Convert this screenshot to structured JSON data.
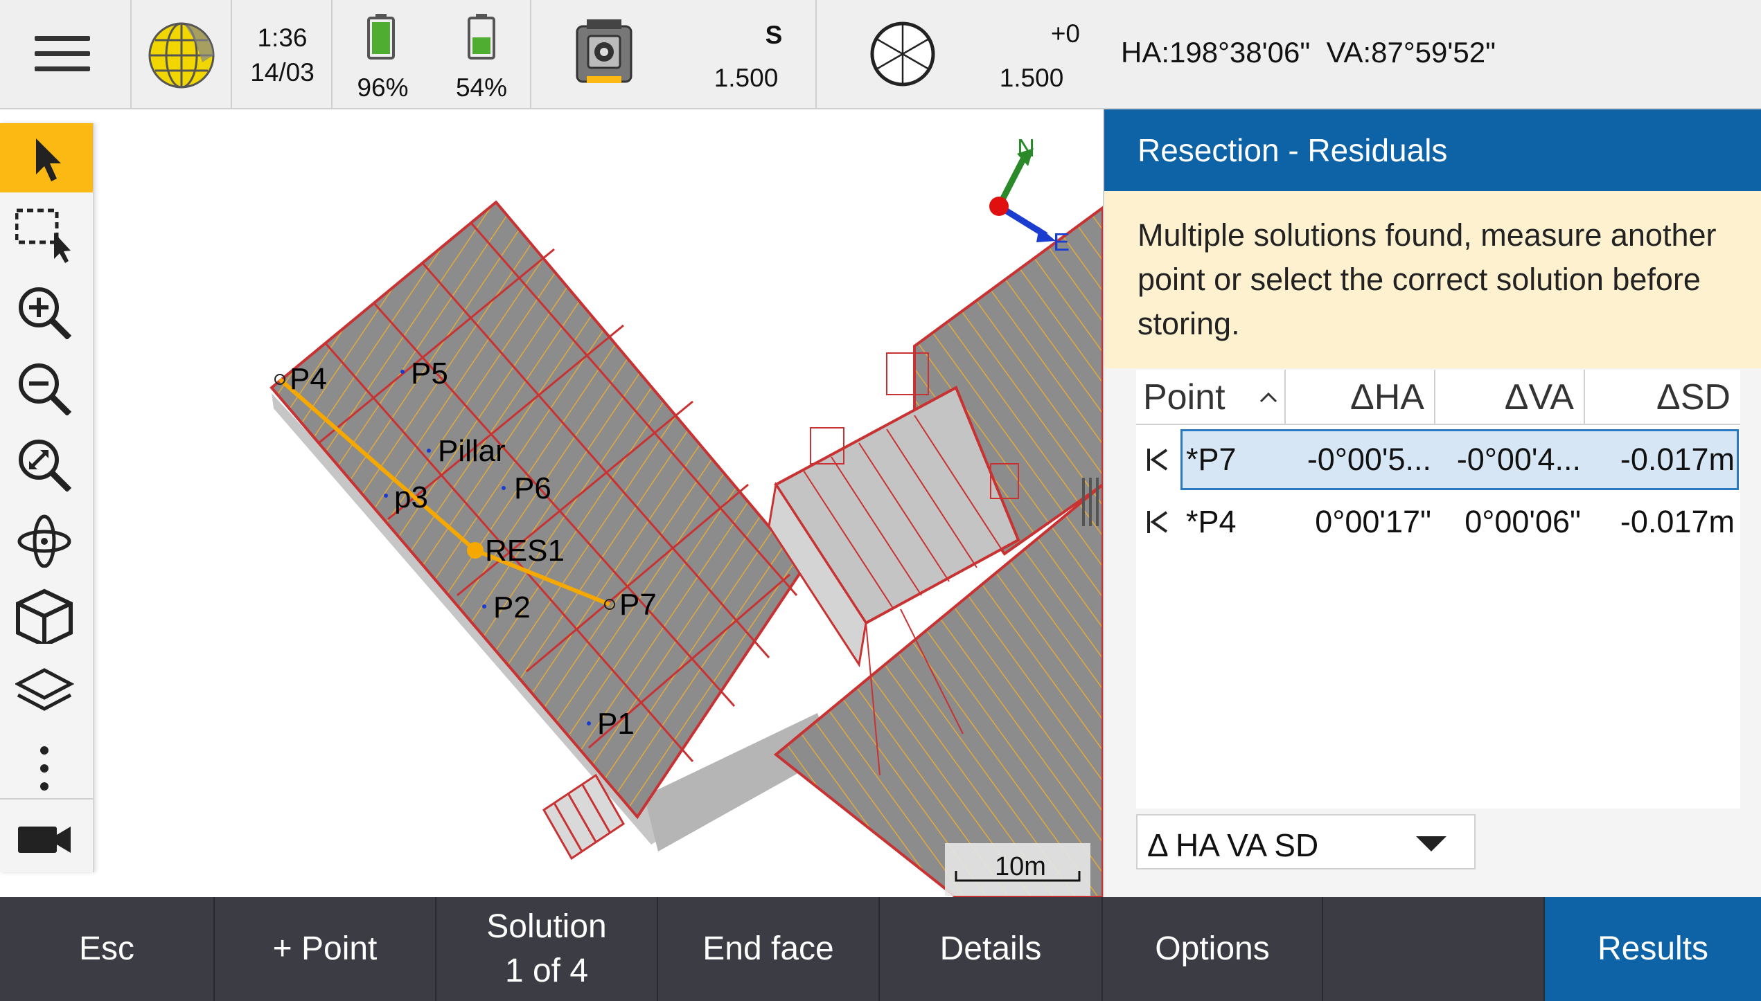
{
  "status_bar": {
    "menu_icon": "hamburger-icon",
    "time": "1:36",
    "date": "14/03",
    "battery_1": "96%",
    "battery_2": "54%",
    "instrument_mode": "S",
    "instrument_height": "1.500",
    "target_offset": "+0",
    "target_height": "1.500"
  },
  "angles": {
    "text": "HA:198°38'06\"  VA:87°59'52\""
  },
  "map": {
    "north_label": "N",
    "east_label": "E",
    "scale_label": "10m",
    "points": [
      "P4",
      "P5",
      "Pillar",
      "P6",
      "p3",
      "RES1",
      "P2",
      "P7",
      "P1"
    ]
  },
  "toolbar": {
    "tools": [
      "select-arrow",
      "select-box",
      "zoom-in",
      "zoom-out",
      "zoom-extents",
      "orbit",
      "view-cube",
      "layers",
      "more",
      "camera"
    ]
  },
  "panel": {
    "title": "Resection - Residuals",
    "warning": "Multiple solutions found, measure another point or select the correct solution before storing.",
    "columns": [
      "Point",
      "ΔHA",
      "ΔVA",
      "ΔSD"
    ],
    "rows": [
      {
        "point": "*P7",
        "dha": "-0°00'5...",
        "dva": "-0°00'4...",
        "dsd": "-0.017m"
      },
      {
        "point": "*P4",
        "dha": "0°00'17\"",
        "dva": "0°00'06\"",
        "dsd": "-0.017m"
      }
    ],
    "dropdown_value": "Δ HA VA SD"
  },
  "bottom_bar": {
    "esc": "Esc",
    "add_point": "+ Point",
    "solution_line1": "Solution",
    "solution_line2": "1 of 4",
    "end_face": "End face",
    "details": "Details",
    "options": "Options",
    "results": "Results"
  },
  "colors": {
    "accent_blue": "#0d63a5",
    "toolbar_active": "#fdb913",
    "warning_bg": "#fdf1cf",
    "bottom_bar": "#3c3c44",
    "resection_line": "#f5a800"
  }
}
